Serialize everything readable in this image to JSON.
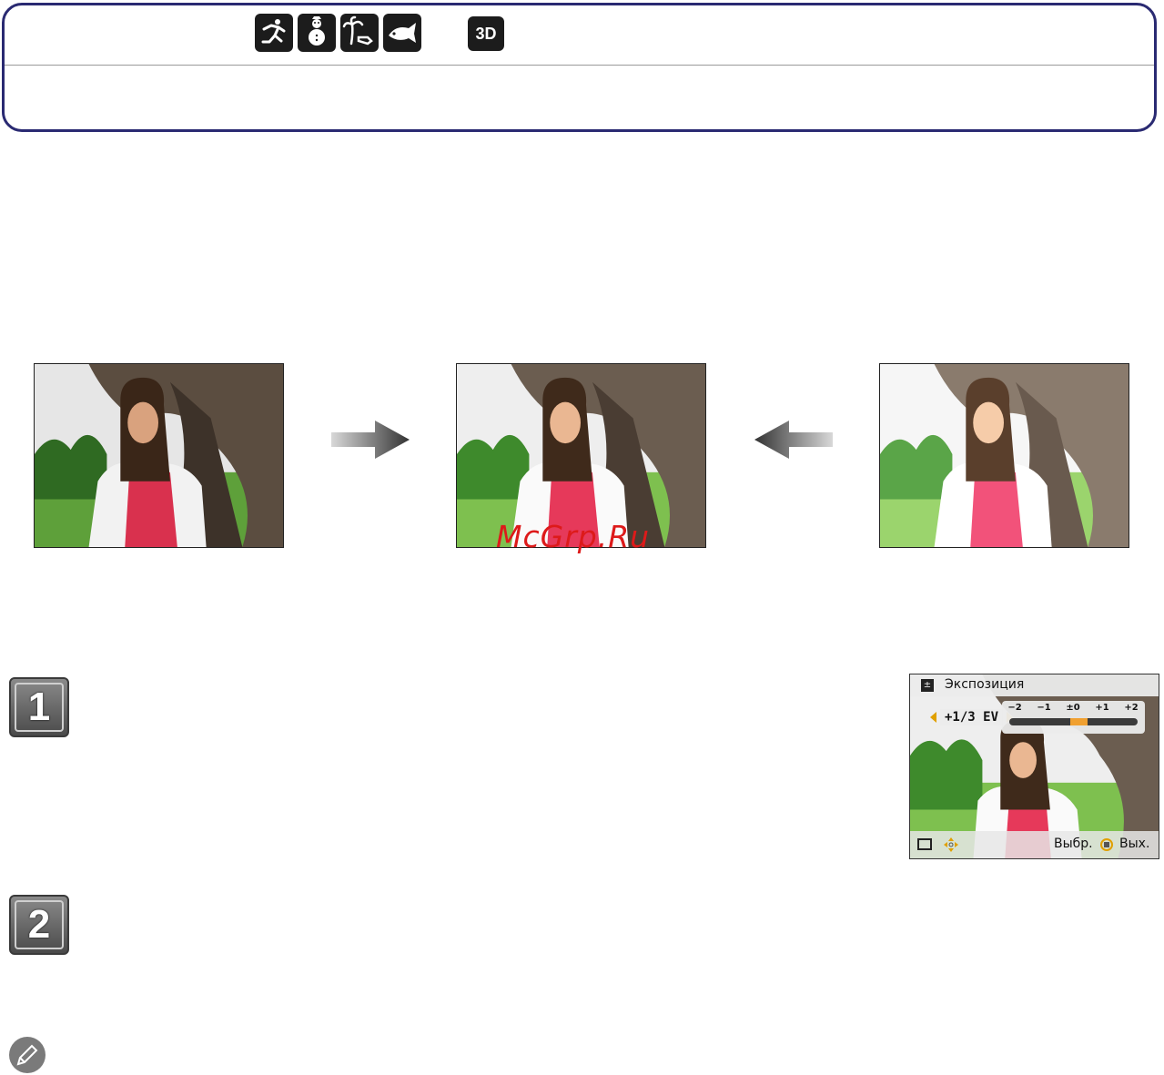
{
  "header": {
    "mode_icons": [
      "sports-mode-icon",
      "snow-mode-icon",
      "beach-mode-icon",
      "underwater-mode-icon"
    ],
    "mode_3d_label": "3D"
  },
  "photos": [
    {
      "name": "underexposed-photo"
    },
    {
      "name": "correct-exposure-photo"
    },
    {
      "name": "overexposed-photo"
    }
  ],
  "watermark": "McGrp.Ru",
  "steps": [
    {
      "number": "1"
    },
    {
      "number": "2"
    }
  ],
  "camera_screen": {
    "title": "Экспозиция",
    "title_icon": "exposure-icon",
    "value": "+1/3 EV",
    "scale_labels": [
      "−2",
      "−1",
      "±0",
      "+1",
      "+2"
    ],
    "exposure_value": 0.33,
    "scale_range": [
      -2,
      2
    ],
    "select_label": "Выбр.",
    "exit_label": "Вых.",
    "accent_color": "#f0a030"
  },
  "note_icon": "pencil-note-icon"
}
